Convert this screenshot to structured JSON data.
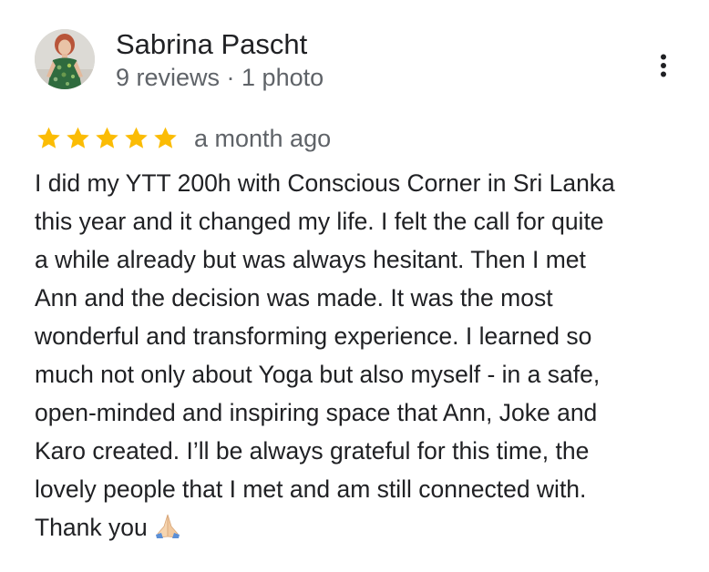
{
  "reviewer": {
    "name": "Sabrina Pascht",
    "meta": "9 reviews · 1 photo",
    "avatar_icon": "user-photo-avatar"
  },
  "menu": {
    "icon": "more-vertical-icon"
  },
  "rating": {
    "value": 5,
    "max": 5,
    "star_color": "#fbbc04",
    "date": "a month ago"
  },
  "review": {
    "lines": [
      "I did my YTT 200h with Conscious Corner in Sri Lanka",
      "this year and it changed my life. I felt the call for quite",
      "a while already but was always hesitant. Then I met",
      "Ann and the decision was made. It was the most",
      "wonderful and transforming experience. I learned so",
      "much not only about Yoga but also myself - in a safe,",
      "open-minded and inspiring space that Ann, Joke and",
      "Karo created. I’ll be always grateful for this time, the",
      "lovely people that I met and am still connected with.",
      "Thank you"
    ],
    "emoji_icon": "folded-hands-emoji"
  }
}
